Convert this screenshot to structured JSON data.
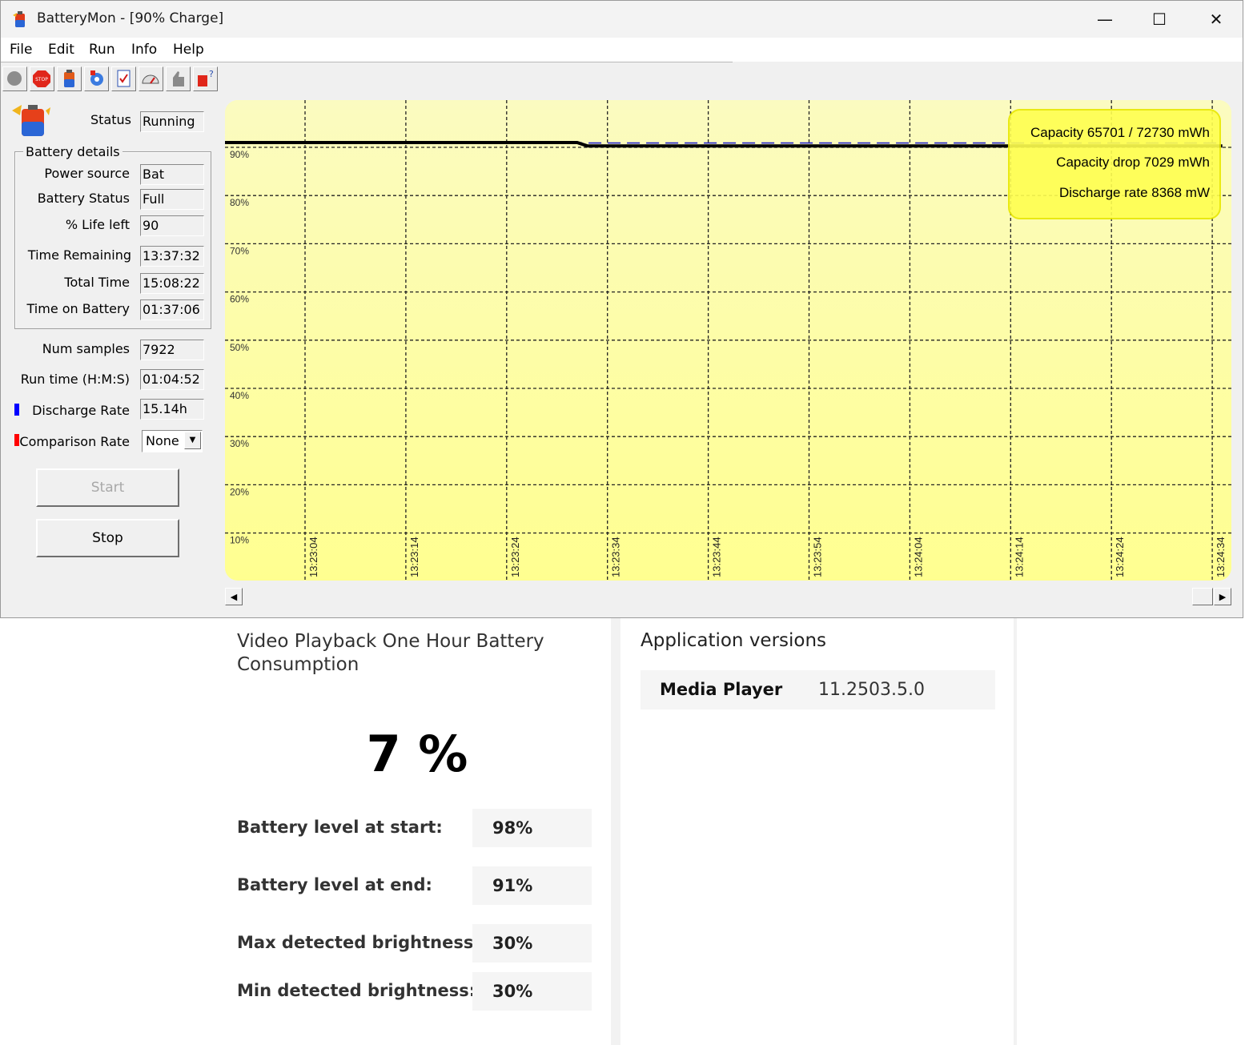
{
  "window": {
    "title": "BatteryMon - [90% Charge]",
    "controls": {
      "minimize": "—",
      "maximize": "☐",
      "close": "✕"
    }
  },
  "menu": [
    "File",
    "Edit",
    "Run",
    "Info",
    "Help"
  ],
  "toolbar": [
    "record-icon",
    "stop-icon",
    "battery-icon",
    "settings-icon",
    "checklist-icon",
    "gauge-icon",
    "thumbs-up-icon",
    "help-icon"
  ],
  "panel": {
    "status_label": "Status",
    "status_value": "Running",
    "group_title": "Battery details",
    "details": [
      {
        "label": "Power source",
        "value": "Bat"
      },
      {
        "label": "Battery Status",
        "value": "Full"
      },
      {
        "label": "% Life left",
        "value": "90"
      },
      {
        "label": "Time Remaining",
        "value": "13:37:32"
      },
      {
        "label": "Total Time",
        "value": "15:08:22"
      },
      {
        "label": "Time on Battery",
        "value": "01:37:06"
      }
    ],
    "num_samples_label": "Num samples",
    "num_samples_value": "7922",
    "run_time_label": "Run time (H:M:S)",
    "run_time_value": "01:04:52",
    "discharge_label": "Discharge Rate",
    "discharge_value": "15.14h",
    "discharge_color": "#0000ff",
    "comparison_label": "Comparison Rate",
    "comparison_value": "None",
    "comparison_color": "#ff0000",
    "start_label": "Start",
    "stop_label": "Stop"
  },
  "chart_data": {
    "type": "line",
    "y_ticks": [
      "90%",
      "80%",
      "70%",
      "60%",
      "50%",
      "40%",
      "30%",
      "20%",
      "10%"
    ],
    "x_ticks": [
      "13:23:04",
      "13:23:14",
      "13:23:24",
      "13:23:34",
      "13:23:44",
      "13:23:54",
      "13:24:04",
      "13:24:14",
      "13:24:24",
      "13:24:34"
    ],
    "ylim": [
      0,
      100
    ],
    "grid": true,
    "background": "#fdfdb4",
    "series": [
      {
        "color": "#000000",
        "x": [
          "13:22:54",
          "13:23:31",
          "13:23:32",
          "13:24:14",
          "13:24:35"
        ],
        "values": [
          91.0,
          91.0,
          90.3,
          90.3,
          90.3
        ]
      },
      {
        "color": "#2222cc",
        "dashed": true,
        "x": [
          "13:22:54",
          "13:23:31",
          "13:23:32",
          "13:24:14",
          "13:24:35"
        ],
        "values": [
          91.0,
          91.0,
          90.9,
          90.9,
          90.9
        ]
      }
    ],
    "annotations": [
      "Capacity 65701 / 72730 mWh",
      "Capacity drop 7029 mWh",
      "Discharge rate 8368 mW"
    ]
  },
  "report": {
    "title": "Video Playback One Hour Battery Consumption",
    "result": "7 %",
    "rows": [
      {
        "label": "Battery level at start:",
        "value": "98%"
      },
      {
        "label": "Battery level at end:",
        "value": "91%"
      },
      {
        "label": "Max detected brightness:",
        "value": "30%"
      },
      {
        "label": "Min detected brightness:",
        "value": "30%"
      }
    ]
  },
  "apps": {
    "title": "Application versions",
    "rows": [
      {
        "name": "Media Player",
        "version": "11.2503.5.0"
      }
    ]
  }
}
